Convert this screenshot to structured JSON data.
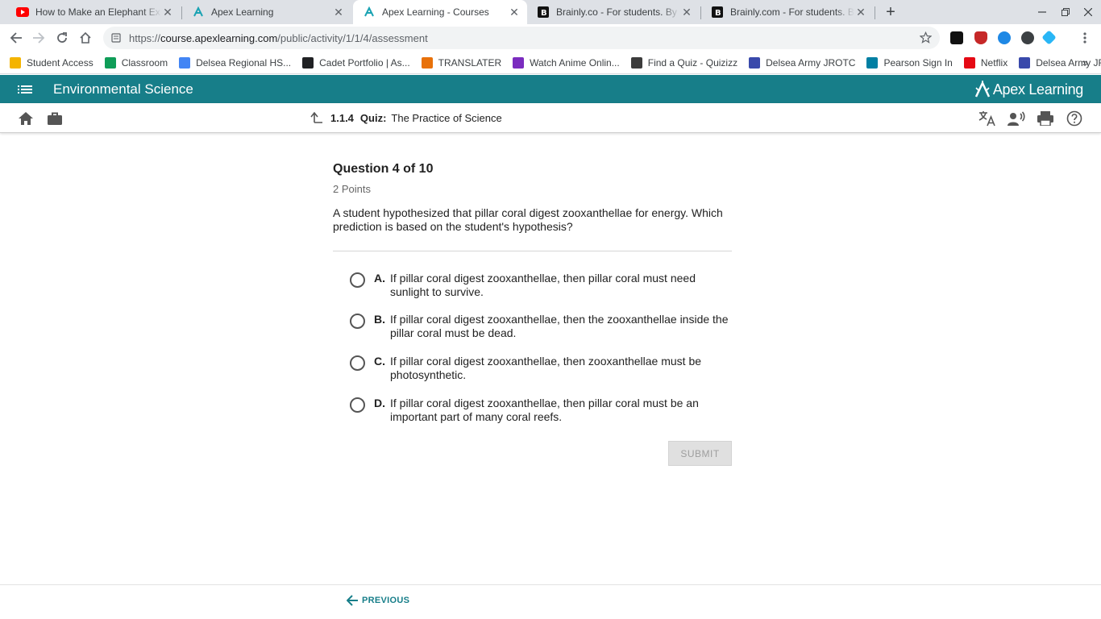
{
  "browser": {
    "tabs": [
      {
        "title": "How to Make an Elephant Explo",
        "favicon": "youtube-icon"
      },
      {
        "title": "Apex Learning",
        "favicon": "apex-icon"
      },
      {
        "title": "Apex Learning - Courses",
        "favicon": "apex-icon",
        "active": true
      },
      {
        "title": "Brainly.co - For students. By stu",
        "favicon": "brainly-icon"
      },
      {
        "title": "Brainly.com - For students. By st",
        "favicon": "brainly-icon"
      }
    ],
    "url_prefix": "https://",
    "url_host": "course.apexlearning.com",
    "url_path": "/public/activity/1/1/4/assessment",
    "bookmarks": [
      {
        "label": "Student Access",
        "color": "#f4b400"
      },
      {
        "label": "Classroom",
        "color": "#0f9d58"
      },
      {
        "label": "Delsea Regional HS...",
        "color": "#4285f4"
      },
      {
        "label": "Cadet Portfolio | As...",
        "color": "#202124"
      },
      {
        "label": "TRANSLATER",
        "color": "#e8710a"
      },
      {
        "label": "Watch Anime Onlin...",
        "color": "#7b2cbf"
      },
      {
        "label": "Find a Quiz - Quizizz",
        "color": "#3c3c3c"
      },
      {
        "label": "Delsea Army JROTC",
        "color": "#3949ab"
      },
      {
        "label": "Pearson Sign In",
        "color": "#007fa3"
      },
      {
        "label": "Netflix",
        "color": "#e50914"
      },
      {
        "label": "Delsea Army JROTC",
        "color": "#3949ab"
      }
    ]
  },
  "apex": {
    "course_title": "Environmental Science",
    "brand": "Apex Learning",
    "brand_color": "#177e89",
    "activity_number": "1.1.4",
    "activity_kind": "Quiz:",
    "activity_title": "The Practice of Science"
  },
  "quiz": {
    "heading": "Question 4 of 10",
    "points": "2 Points",
    "question": "A student hypothesized that pillar coral digest zooxanthellae for energy. Which prediction is based on the student's hypothesis?",
    "choices": [
      {
        "letter": "A.",
        "text": "If pillar coral digest zooxanthellae, then pillar coral must need sunlight to survive."
      },
      {
        "letter": "B.",
        "text": "If pillar coral digest zooxanthellae, then the zooxanthellae inside the pillar coral must be dead."
      },
      {
        "letter": "C.",
        "text": "If pillar coral digest zooxanthellae, then zooxanthellae must be photosynthetic."
      },
      {
        "letter": "D.",
        "text": "If pillar coral digest zooxanthellae, then pillar coral must be an important part of many coral reefs."
      }
    ],
    "submit_label": "SUBMIT",
    "previous_label": "PREVIOUS"
  }
}
